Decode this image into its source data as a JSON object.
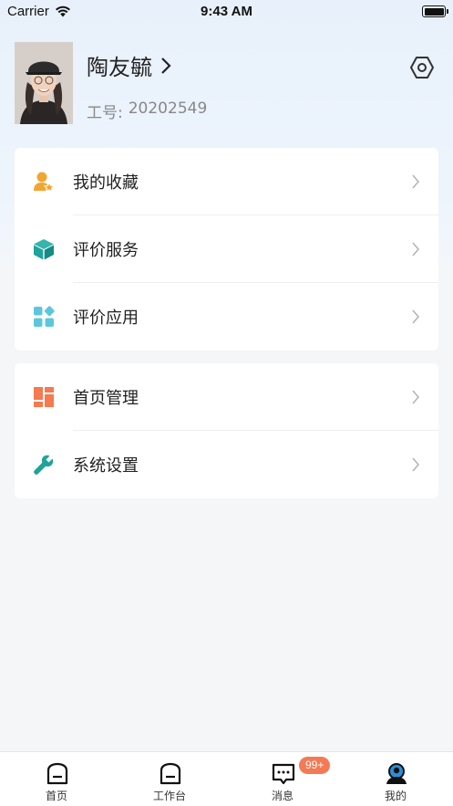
{
  "status_bar": {
    "carrier": "Carrier",
    "time": "9:43 AM"
  },
  "profile": {
    "name": "陶友毓",
    "staff_id_label": "工号:",
    "staff_id": "20202549"
  },
  "menu_group1": [
    {
      "label": "我的收藏",
      "icon": "favorites-person-star-icon",
      "icon_color": "#f3a531"
    },
    {
      "label": "评价服务",
      "icon": "cube-icon",
      "icon_color": "#1fa39a"
    },
    {
      "label": "评价应用",
      "icon": "apps-grid-icon",
      "icon_color": "#5cc7dc"
    }
  ],
  "menu_group2": [
    {
      "label": "首页管理",
      "icon": "dashboard-layout-icon",
      "icon_color": "#f47a4f"
    },
    {
      "label": "系统设置",
      "icon": "wrench-icon",
      "icon_color": "#1fa39a"
    }
  ],
  "tabbar": [
    {
      "label": "首页",
      "icon": "home-icon"
    },
    {
      "label": "工作台",
      "icon": "workbench-icon"
    },
    {
      "label": "消息",
      "icon": "message-icon",
      "badge": "99+"
    },
    {
      "label": "我的",
      "icon": "profile-icon",
      "active": true
    }
  ],
  "colors": {
    "badge": "#f47a55",
    "accent_blue": "#2b8fd8"
  }
}
